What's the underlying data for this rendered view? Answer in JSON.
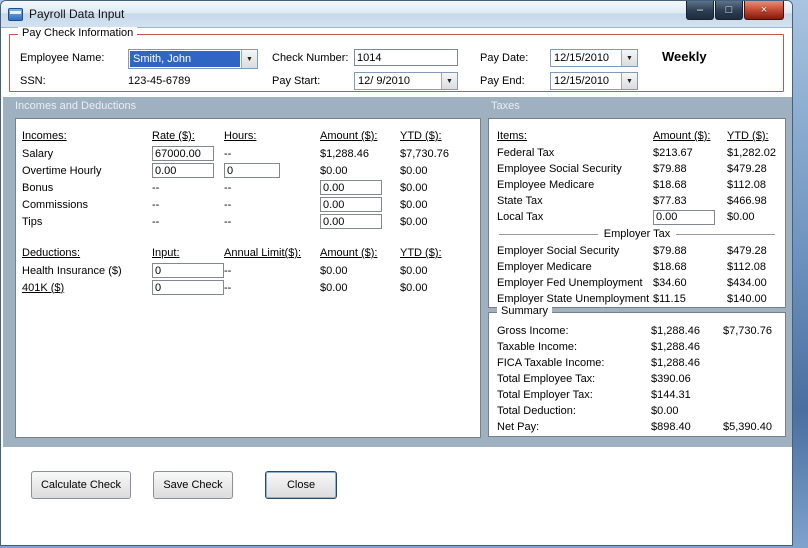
{
  "window": {
    "title": "Payroll Data Input",
    "controls": {
      "minimize": "–",
      "maximize": "□",
      "close": "×"
    }
  },
  "colors": {
    "selection_blue": "#2f66c4",
    "groupbox_border": "#bc5a50",
    "section_header_bg": "#9fb0c0",
    "close_button_red": "#c44a33"
  },
  "paycheck_info": {
    "group_label": "Pay Check Information",
    "employee_name_label": "Employee Name:",
    "employee_name_value": "Smith, John",
    "ssn_label": "SSN:",
    "ssn_value": "123-45-6789",
    "check_number_label": "Check Number:",
    "check_number_value": "1014",
    "pay_start_label": "Pay Start:",
    "pay_start_value": "12/ 9/2010",
    "pay_date_label": "Pay Date:",
    "pay_date_value": "12/15/2010",
    "pay_end_label": "Pay End:",
    "pay_end_value": "12/15/2010",
    "frequency": "Weekly"
  },
  "section_headers": {
    "left": "Incomes and Deductions",
    "right": "Taxes"
  },
  "incomes": {
    "headers": {
      "col0": "Incomes:",
      "col1": "Rate ($):",
      "col2": "Hours:",
      "col3": "Amount ($):",
      "col4": "YTD ($):"
    },
    "rows": [
      {
        "label": "Salary",
        "rate": "67000.00",
        "hours": "--",
        "amount": "$1,288.46",
        "ytd": "$7,730.76"
      },
      {
        "label": "Overtime Hourly",
        "rate": "0.00",
        "hours": "0",
        "amount": "$0.00",
        "ytd": "$0.00"
      },
      {
        "label": "Bonus",
        "rate": "--",
        "hours": "--",
        "amount": "0.00",
        "ytd": "$0.00"
      },
      {
        "label": "Commissions",
        "rate": "--",
        "hours": "--",
        "amount": "0.00",
        "ytd": "$0.00"
      },
      {
        "label": "Tips",
        "rate": "--",
        "hours": "--",
        "amount": "0.00",
        "ytd": "$0.00"
      }
    ]
  },
  "deductions": {
    "headers": {
      "col0": "Deductions:",
      "col1": "Input:",
      "col2": "Annual Limit($):",
      "col3": "Amount ($):",
      "col4": "YTD ($):"
    },
    "rows": [
      {
        "label": "Health Insurance ($)",
        "input": "0",
        "limit": "--",
        "amount": "$0.00",
        "ytd": "$0.00"
      },
      {
        "label": "401K ($)",
        "input": "0",
        "limit": "--",
        "amount": "$0.00",
        "ytd": "$0.00"
      }
    ]
  },
  "taxes": {
    "headers": {
      "col0": "Items:",
      "col1": "Amount ($):",
      "col2": "YTD ($):"
    },
    "employee_rows": [
      {
        "label": "Federal Tax",
        "amount": "$213.67",
        "ytd": "$1,282.02"
      },
      {
        "label": "Employee Social Security",
        "amount": "$79.88",
        "ytd": "$479.28"
      },
      {
        "label": "Employee Medicare",
        "amount": "$18.68",
        "ytd": "$112.08"
      },
      {
        "label": "State Tax",
        "amount": "$77.83",
        "ytd": "$466.98"
      },
      {
        "label": "Local Tax",
        "amount": "0.00",
        "ytd": "$0.00"
      }
    ],
    "employer_divider": "Employer Tax",
    "employer_rows": [
      {
        "label": "Employer Social Security",
        "amount": "$79.88",
        "ytd": "$479.28"
      },
      {
        "label": "Employer Medicare",
        "amount": "$18.68",
        "ytd": "$112.08"
      },
      {
        "label": "Employer Fed Unemployment",
        "amount": "$34.60",
        "ytd": "$434.00"
      },
      {
        "label": "Employer State Unemployment",
        "amount": "$11.15",
        "ytd": "$140.00"
      }
    ]
  },
  "summary": {
    "group_label": "Summary",
    "rows": [
      {
        "label": "Gross Income:",
        "amount": "$1,288.46",
        "ytd": "$7,730.76"
      },
      {
        "label": "Taxable Income:",
        "amount": "$1,288.46",
        "ytd": ""
      },
      {
        "label": "FICA Taxable Income:",
        "amount": "$1,288.46",
        "ytd": ""
      },
      {
        "label": "Total Employee Tax:",
        "amount": "$390.06",
        "ytd": ""
      },
      {
        "label": "Total Employer Tax:",
        "amount": "$144.31",
        "ytd": ""
      },
      {
        "label": "Total Deduction:",
        "amount": "$0.00",
        "ytd": ""
      },
      {
        "label": "Net Pay:",
        "amount": "$898.40",
        "ytd": "$5,390.40"
      }
    ]
  },
  "buttons": {
    "calculate": "Calculate Check",
    "save": "Save Check",
    "close": "Close"
  }
}
